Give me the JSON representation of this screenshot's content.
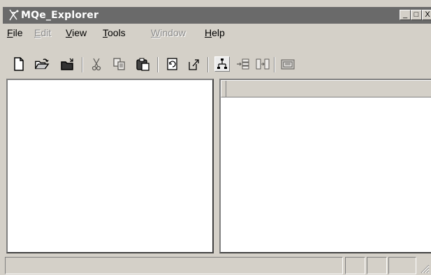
{
  "window": {
    "title": "MQe_Explorer",
    "controls": {
      "minimize": "_",
      "maximize": "□",
      "close": "X"
    }
  },
  "menu": {
    "items": [
      {
        "label": "File",
        "accel": "F",
        "rest": "ile",
        "enabled": true
      },
      {
        "label": "Edit",
        "accel": "E",
        "rest": "dit",
        "enabled": false
      },
      {
        "label": "View",
        "accel": "V",
        "rest": "iew",
        "enabled": true
      },
      {
        "label": "Tools",
        "accel": "T",
        "rest": "ools",
        "enabled": true
      },
      {
        "label": "Window",
        "accel": "W",
        "rest": "indow",
        "enabled": false
      },
      {
        "label": "Help",
        "accel": "H",
        "rest": "elp",
        "enabled": true
      }
    ]
  },
  "toolbar": {
    "buttons": [
      {
        "icon": "new-document-icon",
        "enabled": true
      },
      {
        "icon": "open-folder-icon",
        "enabled": true
      },
      {
        "icon": "close-folder-icon",
        "enabled": true
      },
      {
        "icon": "cut-icon",
        "enabled": false
      },
      {
        "icon": "copy-icon",
        "enabled": false
      },
      {
        "icon": "paste-icon",
        "enabled": true
      },
      {
        "icon": "refresh-icon",
        "enabled": true
      },
      {
        "icon": "export-icon",
        "enabled": true
      },
      {
        "icon": "tree-view-icon",
        "enabled": true
      },
      {
        "icon": "connect-icon",
        "enabled": false
      },
      {
        "icon": "split-icon",
        "enabled": false
      },
      {
        "icon": "properties-icon",
        "enabled": false
      }
    ]
  },
  "statusbar": {
    "message": "",
    "fields": [
      "",
      "",
      ""
    ]
  }
}
